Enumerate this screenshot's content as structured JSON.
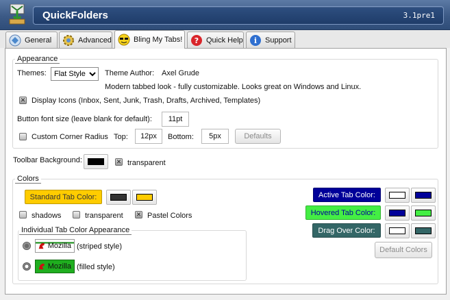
{
  "app": {
    "title": "QuickFolders",
    "version": "3.1pre1"
  },
  "tabs": [
    {
      "label": "General",
      "icon": "general-icon"
    },
    {
      "label": "Advanced",
      "icon": "advanced-gear-icon"
    },
    {
      "label": "Bling My Tabs!",
      "icon": "sunglasses-icon"
    },
    {
      "label": "Quick Help",
      "icon": "help-icon"
    },
    {
      "label": "Support",
      "icon": "info-icon"
    }
  ],
  "active_tab": "Bling My Tabs!",
  "appearance": {
    "legend": "Appearance",
    "themes_label": "Themes:",
    "themes_selected": "Flat Style",
    "theme_author_label": "Theme Author:",
    "theme_author": "Axel Grude",
    "theme_description": "Modern tabbed look - fully customizable. Looks great on Windows and Linux.",
    "display_icons_label": "Display Icons (Inbox, Sent, Junk, Trash, Drafts, Archived, Templates)",
    "display_icons_checked": true,
    "font_size_label": "Button font size (leave blank for default):",
    "font_size_value": "11pt",
    "corner_radius_label": "Custom Corner Radius",
    "corner_radius_checked": false,
    "top_label": "Top:",
    "top_value": "12px",
    "bottom_label": "Bottom:",
    "bottom_value": "5px",
    "defaults_button": "Defaults"
  },
  "toolbar": {
    "background_label": "Toolbar Background:",
    "background_color": "#000000",
    "transparent_label": "transparent",
    "transparent_checked": true
  },
  "colors": {
    "legend": "Colors",
    "standard_tab_label": "Standard Tab Color:",
    "standard_tab_bg": "#ffcc00",
    "standard_swatch_1": "#333333",
    "standard_swatch_2": "#ffcc00",
    "shadows_label": "shadows",
    "shadows_checked": false,
    "transparent_label": "transparent",
    "transparent_checked": false,
    "pastel_label": "Pastel Colors",
    "pastel_checked": true,
    "individual_legend": "Individual Tab Color Appearance",
    "striped_sample": "Mozilla",
    "striped_label": "(striped style)",
    "filled_sample": "Mozilla",
    "filled_label": "(filled style)",
    "selected_style": "filled",
    "active_tab_label": "Active Tab Color:",
    "active_tab_bg": "#000099",
    "active_swatch_1": "#ffffff",
    "active_swatch_2": "#000099",
    "hovered_tab_label": "Hovered Tab Color:",
    "hovered_tab_bg": "#44ee44",
    "hovered_swatch_1": "#000099",
    "hovered_swatch_2": "#44ee44",
    "drag_over_label": "Drag Over Color:",
    "drag_over_bg": "#336666",
    "drag_swatch_1": "#ffffff",
    "drag_swatch_2": "#336666",
    "default_colors_button": "Default Colors"
  }
}
